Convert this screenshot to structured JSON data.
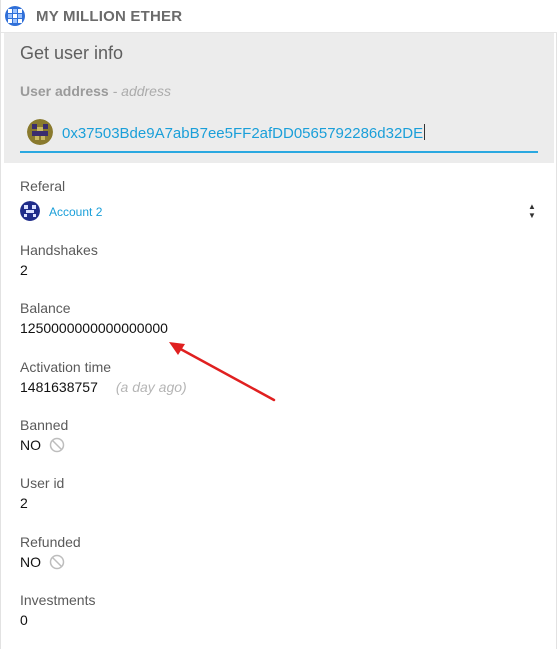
{
  "app": {
    "title": "MY MILLION ETHER"
  },
  "panel": {
    "title": "Get user info",
    "address_label": "User address",
    "address_type": "- address",
    "address_value": "0x37503Bde9A7abB7ee5FF2afDD0565792286d32DE"
  },
  "fields": {
    "referal": {
      "label": "Referal",
      "account": "Account 2"
    },
    "handshakes": {
      "label": "Handshakes",
      "value": "2"
    },
    "balance": {
      "label": "Balance",
      "value": "1250000000000000000"
    },
    "activation": {
      "label": "Activation time",
      "value": "1481638757",
      "relative": "(a day ago)"
    },
    "banned": {
      "label": "Banned",
      "value": "NO"
    },
    "user_id": {
      "label": "User id",
      "value": "2"
    },
    "refunded": {
      "label": "Refunded",
      "value": "NO"
    },
    "investments": {
      "label": "Investments",
      "value": "0"
    }
  },
  "colors": {
    "accent": "#1a9fd9",
    "arrow": "#e02020",
    "panel": "#ececec"
  },
  "icons": {
    "logo": "ether-logo-icon",
    "avatar": "identicon-icon",
    "banned": "ban-icon",
    "spinner": "spinner-arrows-icon"
  }
}
